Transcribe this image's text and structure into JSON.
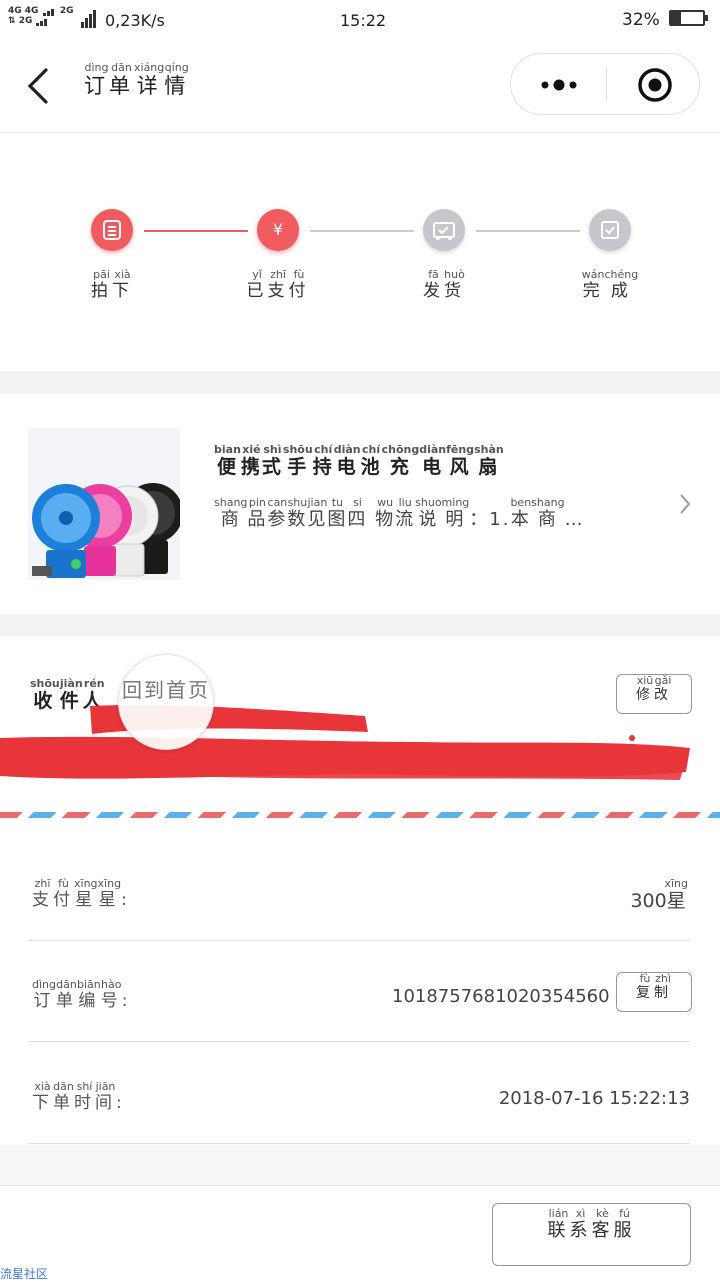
{
  "status_bar": {
    "signal_1": "4G 4G",
    "signal_2": "2G",
    "signal_3": "2G",
    "speed": "0,23K/s",
    "time": "15:22",
    "battery_pct": "32%",
    "battery_level": 0.32
  },
  "nav": {
    "title": [
      {
        "c": "订",
        "p": "dìng"
      },
      {
        "c": "单",
        "p": "dān"
      },
      {
        "c": "详",
        "p": "xiáng"
      },
      {
        "c": "情",
        "p": "qíng"
      }
    ],
    "menu_icon": "more-dots-icon",
    "close_icon": "target-icon"
  },
  "steps": [
    {
      "label": [
        {
          "c": "拍",
          "p": "pāi"
        },
        {
          "c": "下",
          "p": "xià"
        }
      ],
      "icon": "list-icon",
      "state": "done"
    },
    {
      "label": [
        {
          "c": "已",
          "p": "yǐ"
        },
        {
          "c": "支",
          "p": "zhī"
        },
        {
          "c": "付",
          "p": "fù"
        }
      ],
      "icon": "yen-icon",
      "glyph": "¥",
      "state": "done"
    },
    {
      "label": [
        {
          "c": "发",
          "p": "fā"
        },
        {
          "c": "货",
          "p": "huò"
        }
      ],
      "icon": "truck-icon",
      "state": "pending"
    },
    {
      "label": [
        {
          "c": "完",
          "p": "wán"
        },
        {
          "c": "成",
          "p": "chéng"
        }
      ],
      "icon": "check-icon",
      "state": "pending"
    }
  ],
  "colors": {
    "accent": "#ef5b5f",
    "pending": "#c5c7cb",
    "redact": "#e8353a"
  },
  "product": {
    "name": [
      {
        "c": "便",
        "p": "bian"
      },
      {
        "c": "携",
        "p": "xié"
      },
      {
        "c": "式",
        "p": "shì"
      },
      {
        "c": "手",
        "p": "shōu"
      },
      {
        "c": "持",
        "p": "chí"
      },
      {
        "c": "电",
        "p": "diàn"
      },
      {
        "c": "池",
        "p": "chí"
      },
      {
        "c": "充",
        "p": "chōng"
      },
      {
        "c": "电",
        "p": "diàn"
      },
      {
        "c": "风",
        "p": "fēng"
      },
      {
        "c": "扇",
        "p": "shàn"
      }
    ],
    "desc": [
      {
        "c": "商",
        "p": "shang"
      },
      {
        "c": "品",
        "p": "pin"
      },
      {
        "c": "参",
        "p": "can"
      },
      {
        "c": "数",
        "p": "shu"
      },
      {
        "c": "见",
        "p": "jian"
      },
      {
        "c": "图",
        "p": "tu"
      },
      {
        "c": "四",
        "p": "si"
      },
      {
        "c": " ",
        "p": ""
      },
      {
        "c": "物",
        "p": "wu"
      },
      {
        "c": "流",
        "p": "liu"
      },
      {
        "c": "说",
        "p": "shuo"
      },
      {
        "c": "明",
        "p": "ming"
      },
      {
        "c": "：1.",
        "p": ""
      },
      {
        "c": "本",
        "p": "ben"
      },
      {
        "c": "商",
        "p": "shang"
      },
      {
        "c": "…",
        "p": ""
      }
    ]
  },
  "address": {
    "label": [
      {
        "c": "收",
        "p": "shōu"
      },
      {
        "c": "件",
        "p": "jiàn"
      },
      {
        "c": "人",
        "p": "rén"
      }
    ],
    "edit_button": [
      {
        "c": "修",
        "p": "xiū"
      },
      {
        "c": "改",
        "p": "gǎi"
      }
    ],
    "float_button": "回到首页"
  },
  "info": {
    "pay": {
      "label": [
        {
          "c": "支",
          "p": "zhī"
        },
        {
          "c": "付",
          "p": "fù"
        },
        {
          "c": "星",
          "p": "xīng"
        },
        {
          "c": "星",
          "p": "xīng"
        },
        {
          "c": ":",
          "p": ""
        }
      ],
      "amount": "300",
      "unit": [
        {
          "c": "星",
          "p": "xīng"
        }
      ]
    },
    "order_no": {
      "label": [
        {
          "c": "订",
          "p": "dìng"
        },
        {
          "c": "单",
          "p": "dān"
        },
        {
          "c": "编",
          "p": "biān"
        },
        {
          "c": "号",
          "p": "hào"
        },
        {
          "c": ":",
          "p": ""
        }
      ],
      "value": "1018757681020354560",
      "copy_button": [
        {
          "c": "复",
          "p": "fù"
        },
        {
          "c": "制",
          "p": "zhì"
        }
      ]
    },
    "order_time": {
      "label": [
        {
          "c": "下",
          "p": "xià"
        },
        {
          "c": "单",
          "p": "dān"
        },
        {
          "c": "时",
          "p": "shí"
        },
        {
          "c": "间",
          "p": "jiān"
        },
        {
          "c": ":",
          "p": ""
        }
      ],
      "value": "2018-07-16 15:22:13"
    }
  },
  "bottom": {
    "service_button": [
      {
        "c": "联",
        "p": "lián"
      },
      {
        "c": "系",
        "p": "xì"
      },
      {
        "c": "客",
        "p": "kè"
      },
      {
        "c": "服",
        "p": "fú"
      }
    ],
    "watermark": "流星社区"
  }
}
